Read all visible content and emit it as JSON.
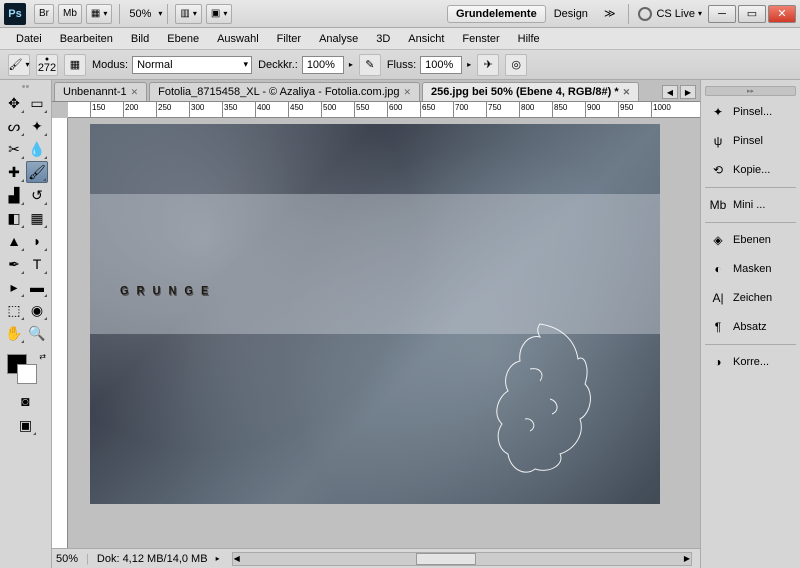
{
  "titlebar": {
    "app": "Ps",
    "bridge": "Br",
    "minibridge": "Mb",
    "zoom": "50%",
    "ws_active": "Grundelemente",
    "ws_next": "Design",
    "cslive": "CS Live"
  },
  "menu": [
    "Datei",
    "Bearbeiten",
    "Bild",
    "Ebene",
    "Auswahl",
    "Filter",
    "Analyse",
    "3D",
    "Ansicht",
    "Fenster",
    "Hilfe"
  ],
  "options": {
    "brush_size": "272",
    "mode_label": "Modus:",
    "mode_value": "Normal",
    "opacity_label": "Deckkr.:",
    "opacity_value": "100%",
    "flow_label": "Fluss:",
    "flow_value": "100%"
  },
  "tabs": [
    {
      "label": "Unbenannt-1",
      "active": false
    },
    {
      "label": "Fotolia_8715458_XL - © Azaliya - Fotolia.com.jpg",
      "active": false
    },
    {
      "label": "256.jpg bei 50% (Ebene 4, RGB/8#) *",
      "active": true
    }
  ],
  "ruler_marks": [
    "150",
    "200",
    "250",
    "300",
    "350",
    "400",
    "450",
    "500",
    "550",
    "600",
    "650",
    "700",
    "750",
    "800",
    "850",
    "900",
    "950",
    "1000"
  ],
  "canvas_text": "GRUNGE",
  "status": {
    "zoom": "50%",
    "doc": "Dok: 4,12 MB/14,0 MB"
  },
  "panels": [
    {
      "icon": "✦",
      "label": "Pinsel..."
    },
    {
      "icon": "ψ",
      "label": "Pinsel"
    },
    {
      "icon": "⟲",
      "label": "Kopie..."
    },
    {
      "sep": true
    },
    {
      "icon": "Mb",
      "label": "Mini ..."
    },
    {
      "sep": true
    },
    {
      "icon": "◈",
      "label": "Ebenen"
    },
    {
      "icon": "◐",
      "label": "Masken"
    },
    {
      "icon": "A|",
      "label": "Zeichen"
    },
    {
      "icon": "¶",
      "label": "Absatz"
    },
    {
      "sep": true
    },
    {
      "icon": "◑",
      "label": "Korre..."
    }
  ]
}
